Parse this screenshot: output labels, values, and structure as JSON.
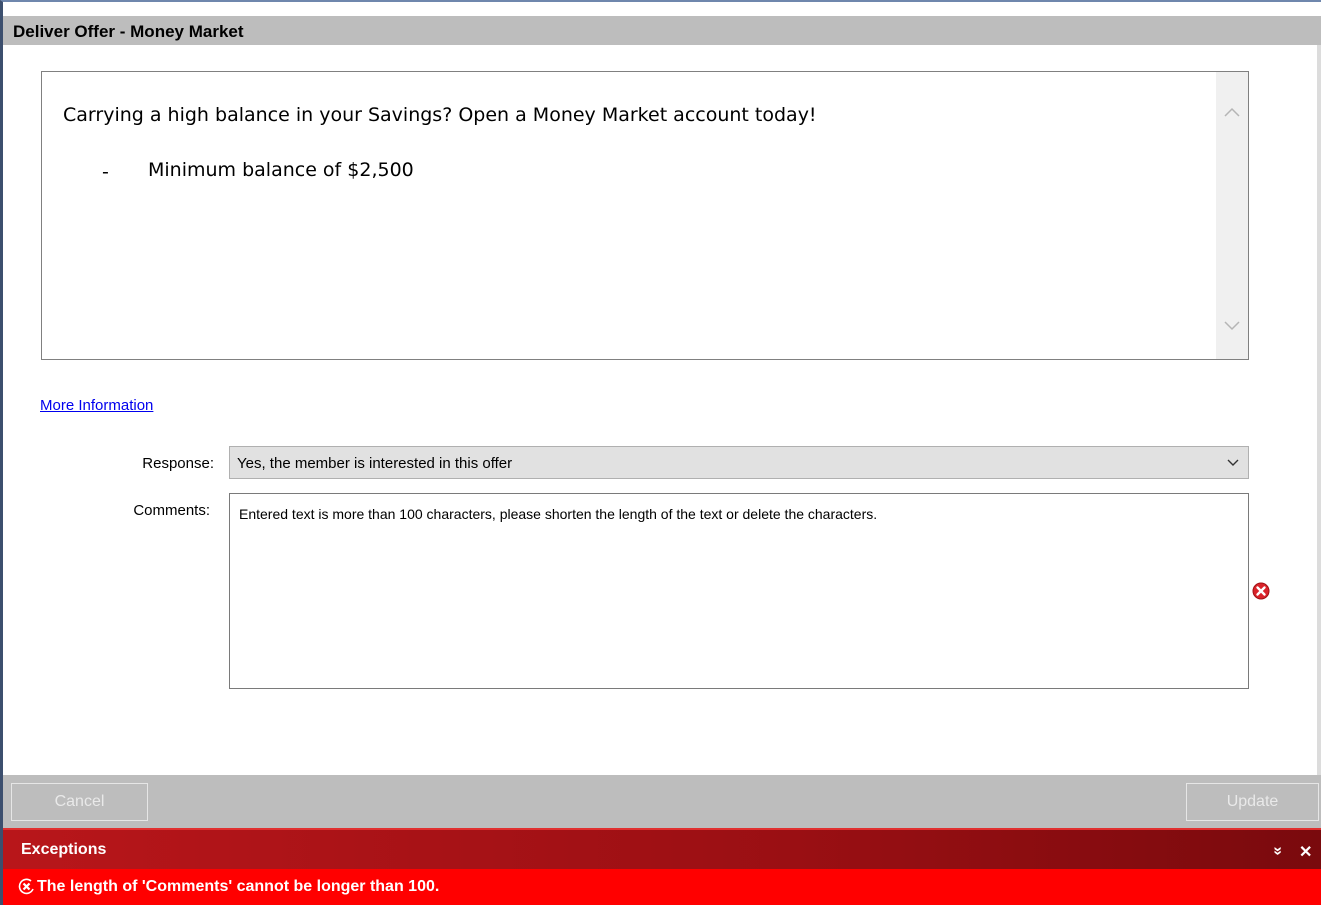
{
  "dialog": {
    "title": "Deliver Offer - Money Market"
  },
  "offer": {
    "line1": "Carrying a high balance in your Savings? Open a Money Market account today!",
    "bullet": "-",
    "line2": "Minimum balance of $2,500"
  },
  "more_info_link": "More Information",
  "form": {
    "response_label": "Response:",
    "response_value": "Yes, the member is interested in this offer",
    "comments_label": "Comments:",
    "comments_value": "Entered text is more than 100 characters, please shorten the length of the text or delete the characters."
  },
  "buttons": {
    "cancel": "Cancel",
    "update": "Update"
  },
  "exceptions": {
    "title": "Exceptions",
    "collapse_glyph": "»",
    "close_glyph": "✕",
    "message": "The length of 'Comments' cannot be longer than 100."
  },
  "colors": {
    "titlebar": "#bdbdbd",
    "exception_header": "#9a0f13",
    "exception_body": "#ff0000",
    "link": "#0000ee",
    "error_icon": "#d9232a"
  }
}
